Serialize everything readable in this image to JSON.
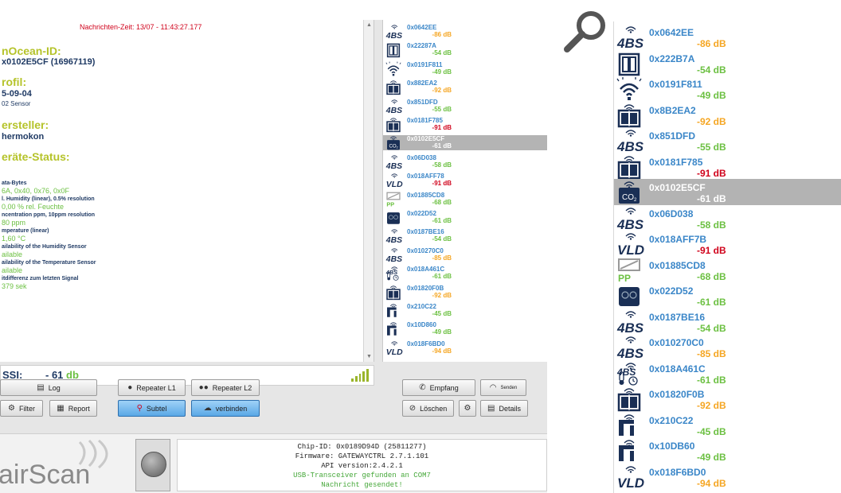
{
  "colors": {
    "value_good": "#6cc042",
    "value_warn": "#f5a623",
    "value_bad": "#d0021b",
    "tag_blue": "#3a86c8",
    "heading_yellowgreen": "#b5c32a",
    "navy": "#1f3a64"
  },
  "header": {
    "message_time": "Nachrichten-Zeit: 13/07 - 11:43:27.177"
  },
  "detail": {
    "enocean_id_label": "nOcean-ID:",
    "enocean_id_value": "x0102E5CF (16967119)",
    "profile_label": "rofil:",
    "profile_value": "5-09-04",
    "profile_sub": "02 Sensor",
    "manufacturer_label": "ersteller:",
    "manufacturer_value": "hermokon",
    "status_label": "eräte-Status:",
    "status_lines": [
      {
        "label": "ata-Bytes",
        "value": "6A, 0x40, 0x76, 0x0F"
      },
      {
        "label": "l. Humidity (linear), 0.5% resolution",
        "value": "0,00 % rel. Feuchte"
      },
      {
        "label": "ncentration ppm, 10ppm resolution",
        "value": "80 ppm"
      },
      {
        "label": "mperature (linear)",
        "value": "1,60 °C"
      },
      {
        "label": "ailability of the Humidity Sensor",
        "value": "ailable"
      },
      {
        "label": "ailability of the Temperature Sensor",
        "value": "ailable"
      },
      {
        "label": "itdifferenz zum letzten Signal",
        "value": "379 sek"
      }
    ],
    "rssi_label": "SSI:",
    "rssi_value": "- 61",
    "rssi_unit": "db"
  },
  "devices": [
    {
      "id": "0x0642EE",
      "db": "-86 dB",
      "level": "warn",
      "icon": "4bs-icon"
    },
    {
      "id": "0x222B7A",
      "db": "-54 dB",
      "level": "good",
      "icon": "window-contact-icon"
    },
    {
      "id": "0x0191F811",
      "db": "-49 dB",
      "level": "good",
      "icon": "rocker-switch-icon"
    },
    {
      "id": "0x8B2EA2",
      "db": "-92 dB",
      "level": "warn",
      "icon": "double-door-icon"
    },
    {
      "id": "0x851DFD",
      "db": "-55 dB",
      "level": "good",
      "icon": "4bs-icon"
    },
    {
      "id": "0x0181F785",
      "db": "-91 dB",
      "level": "bad",
      "icon": "double-door-icon"
    },
    {
      "id": "0x0102E5CF",
      "db": "-61 dB",
      "level": "sel",
      "icon": "co2-sensor-icon",
      "selected": true
    },
    {
      "id": "0x06D038",
      "db": "-58 dB",
      "level": "good",
      "icon": "4bs-icon"
    },
    {
      "id": "0x018AFF7B",
      "db": "-91 dB",
      "level": "bad",
      "icon": "vld-icon"
    },
    {
      "id": "0x01885CD8",
      "db": "-68 dB",
      "level": "good",
      "icon": "pp-module-icon"
    },
    {
      "id": "0x022D52",
      "db": "-61 dB",
      "level": "good",
      "icon": "dual-switch-icon"
    },
    {
      "id": "0x0187BE16",
      "db": "-54 dB",
      "level": "good",
      "icon": "4bs-icon"
    },
    {
      "id": "0x010270C0",
      "db": "-85 dB",
      "level": "warn",
      "icon": "4bs-icon"
    },
    {
      "id": "0x018A461C",
      "db": "-61 dB",
      "level": "good",
      "icon": "thermometer-clock-icon"
    },
    {
      "id": "0x01820F0B",
      "db": "-92 dB",
      "level": "warn",
      "icon": "double-door-icon"
    },
    {
      "id": "0x210C22",
      "db": "-45 dB",
      "level": "good",
      "icon": "door-handle-icon"
    },
    {
      "id": "0x10DB60",
      "db": "-49 dB",
      "level": "good",
      "icon": "door-handle-icon"
    },
    {
      "id": "0x018F6BD0",
      "db": "-94 dB",
      "level": "warn",
      "icon": "vld-icon"
    }
  ],
  "devices_small_ids": [
    "0x0642EE",
    "0x22287A",
    "0x0191F811",
    "0x882EA2",
    "0x851DFD",
    "0x0181F785",
    "0x0102E5CF",
    "0x06D038",
    "0x018AFF78",
    "0x01885CD8",
    "0x022D52",
    "0x0187BE16",
    "0x010270C0",
    "0x018A461C",
    "0x01820F0B",
    "0x210C22",
    "0x10D860",
    "0x018F6BD0"
  ],
  "buttons": {
    "log": "Log",
    "filter": "Filter",
    "report": "Report",
    "repeater_l1": "Repeater L1",
    "repeater_l2": "Repeater L2",
    "subtel": "Subtel",
    "verbinden": "verbinden",
    "empfang": "Empfang",
    "senden": "Senden",
    "loeschen": "Löschen",
    "details": "Details"
  },
  "footer": {
    "logo": "airScan",
    "info_lines": [
      "Chip-ID: 0x0189D94D (25811277)",
      "Firmware: GATEWAYCTRL 2.7.1.101",
      "API version:2.4.2.1",
      "USB-Transceiver gefunden an COM7",
      "Nachricht gesendet!"
    ]
  }
}
